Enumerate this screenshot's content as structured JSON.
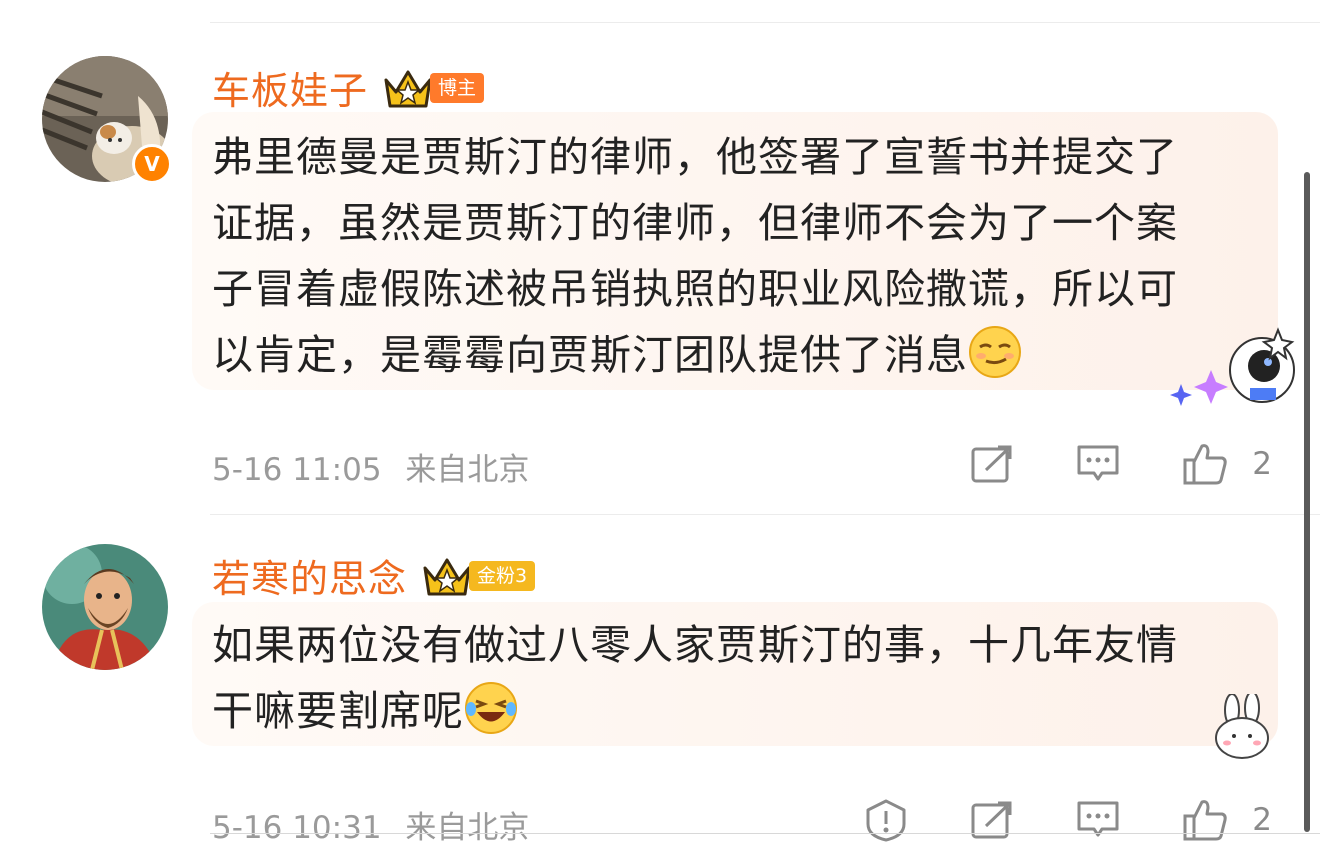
{
  "comments": [
    {
      "username": "车板娃子",
      "badge": "博主",
      "badge_color": "#ff7a2b",
      "verified": "V",
      "content_lines": [
        "弗里德曼是贾斯汀的律师，他签署了宣誓书并提交了",
        "证据，虽然是贾斯汀的律师，但律师不会为了一个案",
        "子冒着虚假陈述被吊销执照的职业风险撒谎，所以可",
        "以肯定，是霉霉向贾斯汀团队提供了消息"
      ],
      "timestamp": "5-16 11:05",
      "location": "来自北京",
      "likes": "2",
      "emoji": "smug-face-emoji"
    },
    {
      "username": "若寒的思念",
      "badge": "金粉3",
      "badge_color": "#f5b81f",
      "content_lines": [
        "如果两位没有做过八零人家贾斯汀的事，十几年友情",
        "干嘛要割席呢"
      ],
      "timestamp": "5-16 10:31",
      "location": "来自北京",
      "likes": "2",
      "emoji": "laughing-tears-emoji"
    }
  ],
  "colors": {
    "username": "#ee6a1f",
    "text": "#222222",
    "meta": "#9a9a9a",
    "icon": "#8a8a8a"
  }
}
